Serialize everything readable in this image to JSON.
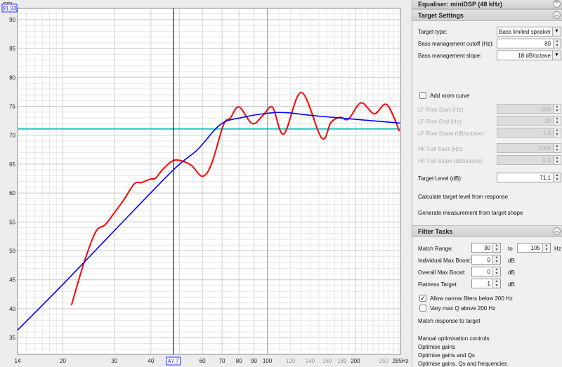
{
  "chart": {
    "y_unit": "SPL",
    "cursor_readout_y": "91.93",
    "cursor_readout_x": "47.7",
    "y_ticks": [
      35,
      40,
      45,
      50,
      55,
      60,
      65,
      70,
      75,
      80,
      85,
      90
    ],
    "x_ticks": [
      {
        "v": 14,
        "l": "14"
      },
      {
        "v": 20,
        "l": "20"
      },
      {
        "v": 30,
        "l": "30"
      },
      {
        "v": 40,
        "l": "40"
      },
      {
        "v": 60,
        "l": "60"
      },
      {
        "v": 70,
        "l": "70"
      },
      {
        "v": 80,
        "l": "80"
      },
      {
        "v": 90,
        "l": "90"
      },
      {
        "v": 100,
        "l": "100"
      },
      {
        "v": 120,
        "l": "120",
        "dim": true
      },
      {
        "v": 140,
        "l": "140",
        "dim": true
      },
      {
        "v": 160,
        "l": "160",
        "dim": true
      },
      {
        "v": 180,
        "l": "180",
        "dim": true
      },
      {
        "v": 200,
        "l": "200"
      },
      {
        "v": 250,
        "l": "250",
        "dim": true
      },
      {
        "v": 285,
        "l": "285Hz"
      }
    ],
    "colors": {
      "measurement": "#ff0000",
      "target": "#0000ff",
      "target_level": "#20c8c8",
      "cursor": "#000000"
    }
  },
  "chart_data": {
    "type": "line",
    "xscale": "log",
    "xlim": [
      14,
      285
    ],
    "ylim": [
      32.1,
      91.93
    ],
    "ylabel": "SPL",
    "xlabel": "Hz",
    "cursor_x": 47.7,
    "target_level": 71.1,
    "series": [
      {
        "name": "measurement",
        "x": [
          21.4,
          23.6,
          25.9,
          27.9,
          29.8,
          32.3,
          35.1,
          37.1,
          39.7,
          41.5,
          44.3,
          48.4,
          54.6,
          60,
          64.5,
          70.8,
          74.8,
          80,
          88.8,
          96.5,
          104.2,
          113.8,
          130.7,
          153.4,
          164.9,
          177.1,
          189.3,
          209,
          232,
          256,
          283
        ],
        "y": [
          40.6,
          47.9,
          53.3,
          54.5,
          56.4,
          58.8,
          61.6,
          61.8,
          62.4,
          62.6,
          64.3,
          65.7,
          64.9,
          62.9,
          65.1,
          71.8,
          73.0,
          74.9,
          72.0,
          73.4,
          74.8,
          70.2,
          77.4,
          69.5,
          72.2,
          73.1,
          72.8,
          75.6,
          73.7,
          75.3,
          70.7
        ]
      },
      {
        "name": "target",
        "x": [
          14,
          20,
          30,
          47.7,
          57.7,
          69.3,
          82.6,
          100.3,
          116.4,
          150,
          285
        ],
        "y": [
          36.3,
          44.2,
          53.5,
          64.0,
          67.5,
          71.9,
          73.1,
          73.8,
          73.9,
          73.3,
          72.1
        ]
      }
    ]
  },
  "panel": {
    "equaliser_title": "Equaliser: miniDSP (48 kHz)",
    "target_settings": {
      "title": "Target Settings",
      "target_type_label": "Target type:",
      "target_type_value": "Bass limited speaker",
      "cutoff_label": "Bass management cutoff (Hz):",
      "cutoff_value": "80",
      "slope_label": "Bass management slope:",
      "slope_value": "18 dB/octave",
      "room_curve_label": "Add room curve",
      "lf_rise_start_label": "LF Rise Start (Hz):",
      "lf_rise_start_value": "200",
      "lf_rise_end_label": "LF Rise End (Hz):",
      "lf_rise_end_value": "20",
      "lf_rise_slope_label": "LF Rise Slope (dB/octave):",
      "lf_rise_slope_value": "1.0",
      "hf_fall_start_label": "HF Fall Start (Hz):",
      "hf_fall_start_value": "1000",
      "hf_fall_slope_label": "HF Fall Slope (dB/octave):",
      "hf_fall_slope_value": "0.5",
      "target_level_label": "Target Level (dB):",
      "target_level_value": "71.1",
      "calc_link": "Calculate target level from response",
      "generate_link": "Generate measurement from target shape"
    },
    "filter_tasks": {
      "title": "Filter Tasks",
      "match_range_label": "Match Range:",
      "match_from": "30",
      "to_label": "to",
      "match_to": "105",
      "hz_label": "Hz",
      "ind_boost_label": "Individual Max Boost:",
      "ind_boost_value": "0",
      "overall_boost_label": "Overall Max Boost:",
      "overall_boost_value": "0",
      "flatness_label": "Flatness Target:",
      "flatness_value": "1",
      "db_label": "dB",
      "allow_narrow_label": "Allow narrow filters below 200 Hz",
      "allow_narrow_checked": true,
      "vary_q_label": "Vary max Q above 200 Hz",
      "vary_q_checked": false,
      "match_link": "Match response to target",
      "manual_link": "Manual optimisation controls",
      "opt_gains": "Optimise gains",
      "opt_gains_qs": "Optimise gains and Qs",
      "opt_all": "Optimise gains, Qs and frequencies"
    }
  }
}
